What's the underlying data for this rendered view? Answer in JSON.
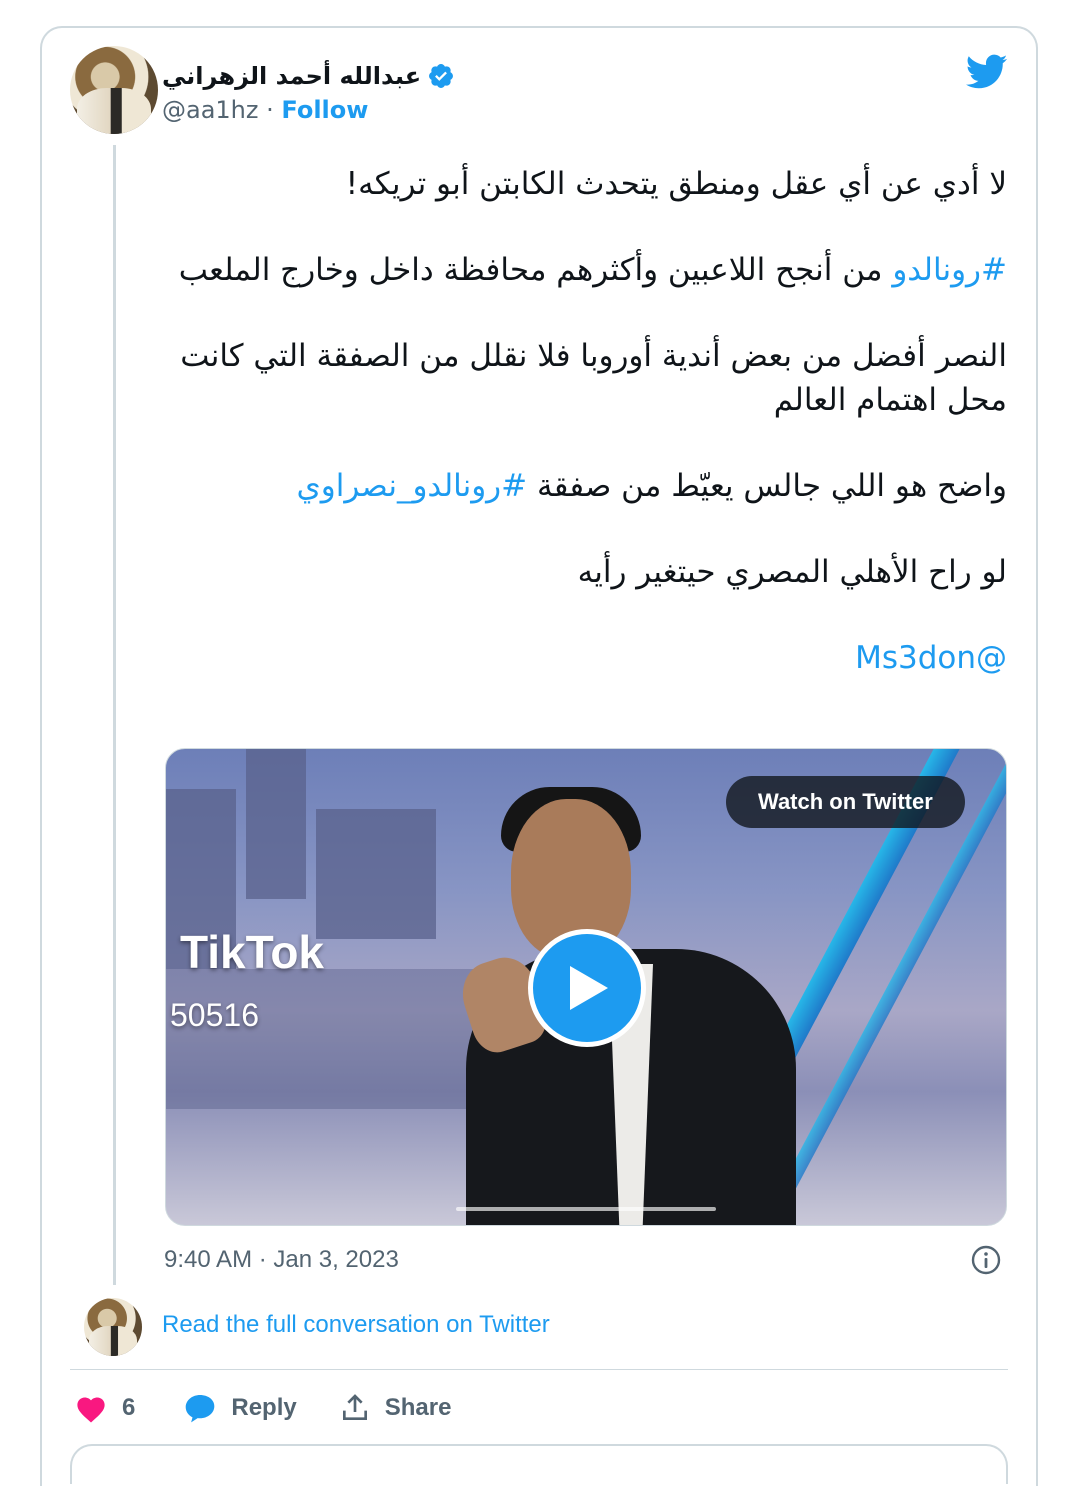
{
  "author": {
    "display_name": "عبدالله أحمد الزهراني",
    "handle": "@aa1hz",
    "separator": "·",
    "follow_label": "Follow"
  },
  "tweet": {
    "line1": "لا أدي عن أي عقل ومنطق يتحدث الكابتن أبو تريكه!",
    "hashtag1": "#رونالدو",
    "line2_rest": " من أنجح اللاعبين وأكثرهم محافظة داخل وخارج الملعب",
    "line3": "النصر أفضل من بعض أندية أوروبا فلا نقلل من الصفقة التي كانت محل اهتمام العالم",
    "line4_prefix": "واضح هو اللي جالس يعيّط من صفقة ",
    "hashtag2": "#رونالدو_نصراوي",
    "line5": "لو راح الأهلي المصري حيتغير رأيه",
    "mention": "@Ms3don"
  },
  "media": {
    "watch_label": "Watch on Twitter",
    "overlay_brand": "TikTok",
    "overlay_number": "50516"
  },
  "meta": {
    "timestamp": "9:40 AM · Jan 3, 2023"
  },
  "conversation": {
    "read_label": "Read the full conversation on Twitter"
  },
  "actions": {
    "like_count": "6",
    "reply_label": "Reply",
    "share_label": "Share"
  },
  "colors": {
    "accent": "#1d9bf0",
    "like": "#f91880",
    "secondary_text": "#536471",
    "border": "#cfd9de"
  },
  "icons": [
    "twitter-bird-icon",
    "verified-badge-icon",
    "play-icon",
    "info-icon",
    "heart-icon",
    "reply-bubble-icon",
    "share-icon"
  ]
}
